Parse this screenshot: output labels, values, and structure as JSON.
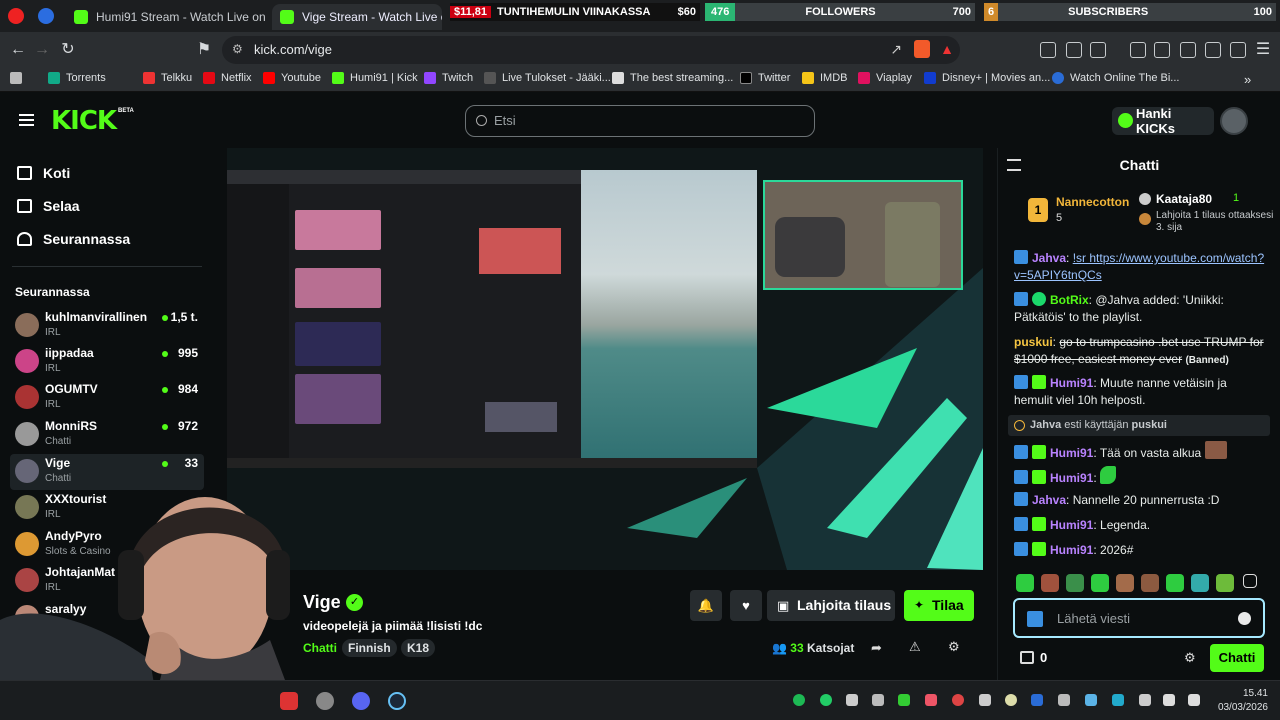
{
  "browser": {
    "tabs": [
      {
        "label": "Humi91 Stream - Watch Live on Kick",
        "active": false
      },
      {
        "label": "Vige Stream - Watch Live on Kick",
        "active": true
      }
    ],
    "overlay": {
      "goal_amount": "$11,81",
      "goal_label": "TUNTIHEMULIN VIINAKASSA",
      "goal_target": "$60",
      "followers_count": "476",
      "followers_label": "FOLLOWERS",
      "followers_target": "700",
      "subs_count": "6",
      "subs_label": "SUBSCRIBERS",
      "subs_target": "100"
    },
    "url": "kick.com/vige",
    "bookmarks": [
      {
        "label": "Torrents",
        "color": "#e33"
      },
      {
        "label": "Telkku",
        "color": "#e33"
      },
      {
        "label": "Netflix",
        "color": "#e50914"
      },
      {
        "label": "Youtube",
        "color": "#ff0000"
      },
      {
        "label": "Humi91 | Kick",
        "color": "#53fc18"
      },
      {
        "label": "Twitch",
        "color": "#9146ff"
      },
      {
        "label": "Live Tulokset - Jääki...",
        "color": "#444"
      },
      {
        "label": "The best streaming...",
        "color": "#ddd"
      },
      {
        "label": "Twitter",
        "color": "#111"
      },
      {
        "label": "IMDB",
        "color": "#f5c518"
      },
      {
        "label": "Viaplay",
        "color": "#e0115f"
      },
      {
        "label": "Disney+ | Movies an...",
        "color": "#113ccf"
      },
      {
        "label": "Watch Online The Bi...",
        "color": "#2a6cd6"
      }
    ]
  },
  "header": {
    "logo": "KICK",
    "beta": "BETA",
    "search_placeholder": "Etsi",
    "get_kicks": "Hanki KICKs"
  },
  "sidebar": {
    "nav": [
      {
        "label": "Koti"
      },
      {
        "label": "Selaa"
      },
      {
        "label": "Seurannassa"
      }
    ],
    "following_title": "Seurannassa",
    "channels": [
      {
        "name": "kuhlmanvirallinen",
        "category": "IRL",
        "viewers": "1,5 t.",
        "color": "#8a6d5a"
      },
      {
        "name": "iippadaa",
        "category": "IRL",
        "viewers": "995",
        "color": "#c48"
      },
      {
        "name": "OGUMTV",
        "category": "IRL",
        "viewers": "984",
        "color": "#a33"
      },
      {
        "name": "MonniRS",
        "category": "Chatti",
        "viewers": "972",
        "color": "#999"
      },
      {
        "name": "Vige",
        "category": "Chatti",
        "viewers": "33",
        "color": "#667"
      },
      {
        "name": "XXXtourist",
        "category": "IRL",
        "viewers": "",
        "color": "#775"
      },
      {
        "name": "AndyPyro",
        "category": "Slots & Casino",
        "viewers": "",
        "color": "#d93"
      },
      {
        "name": "JohtajanMat",
        "category": "IRL",
        "viewers": "",
        "color": "#a44"
      },
      {
        "name": "saralyy",
        "category": "",
        "viewers": "",
        "color": "#b87"
      }
    ]
  },
  "stream": {
    "name": "Vige",
    "title": "videopelejä ja piimää !lisisti !dc",
    "category": "Chatti",
    "tags": [
      "Finnish",
      "K18"
    ],
    "gift_label": "Lahjoita tilaus",
    "subscribe_label": "Tilaa",
    "viewers_count": "33",
    "viewers_label": "Katsojat"
  },
  "chat": {
    "title": "Chatti",
    "pinned": {
      "rank1_name": "Nannecotton",
      "rank1_count": "5",
      "rank2_name": "Kaataja80",
      "rank2_count": "1",
      "rank3_text": "Lahjoita 1 tilaus ottaaksesi 3. sija"
    },
    "messages": [
      {
        "user": "Jahva",
        "color": "#b983ff",
        "text": "!sr https://www.youtube.com/watch?v=5APIY6tnQCs",
        "link": true,
        "badges": [
          "mod"
        ]
      },
      {
        "user": "BotRix",
        "color": "#53fc18",
        "text": "@Jahva added: 'Uniikki: Pätkätöis' to the playlist.",
        "badges": [
          "mod",
          "ver"
        ]
      },
      {
        "user": "puskui",
        "color": "#f5c542",
        "text": "go to trumpcasino .bet use TRUMP for $1000 free, easiest money ever",
        "suffix": "(Banned)",
        "badges": []
      },
      {
        "user": "Humi91",
        "color": "#b983ff",
        "text": "Muute nanne vetäisin ja hemulit viel 10h helposti.",
        "badges": [
          "mod",
          "sub"
        ]
      },
      {
        "user": "Humi91",
        "color": "#b983ff",
        "text": "Tää on vasta alkua",
        "badges": [
          "mod",
          "sub"
        ]
      },
      {
        "user": "Humi91",
        "color": "#b983ff",
        "text": "",
        "badges": [
          "mod",
          "sub"
        ]
      },
      {
        "user": "Jahva",
        "color": "#b983ff",
        "text": "Nannelle 20 punnerrusta :D",
        "badges": [
          "mod"
        ]
      },
      {
        "user": "Humi91",
        "color": "#b983ff",
        "text": "Legenda.",
        "badges": [
          "mod",
          "sub"
        ]
      },
      {
        "user": "Humi91",
        "color": "#b983ff",
        "text": "2026#",
        "badges": [
          "mod",
          "sub"
        ]
      }
    ],
    "ban_notice_user": "Jahva",
    "ban_notice_text": "esti käyttäjän",
    "ban_notice_target": "puskui",
    "input_placeholder": "Lähetä viesti",
    "kicks": "0",
    "send_label": "Chatti"
  },
  "taskbar": {
    "time": "15.41",
    "date": "03/03/2026"
  }
}
